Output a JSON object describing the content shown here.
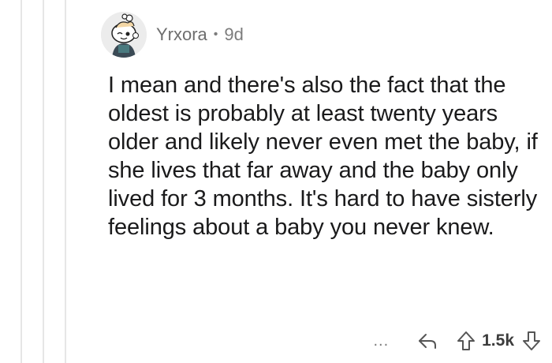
{
  "comment": {
    "author": "Yrxora",
    "separator": "•",
    "age": "9d",
    "body": "I mean and there's also the fact that the oldest is probably at least twenty years older and likely never even met the baby, if she lives that far away and the baby only lived for 3 months. It's hard to have sisterly feelings about a baby you never knew.",
    "score": "1.5k",
    "more_label": "..."
  },
  "icons": {
    "avatar": "snoo-avatar-icon",
    "reply": "reply-arrow-icon",
    "upvote": "upvote-arrow-icon",
    "downvote": "downvote-arrow-icon"
  },
  "colors": {
    "text": "#1a1a1b",
    "meta": "#7c7c7c",
    "thread_line": "#e6e6e6"
  }
}
